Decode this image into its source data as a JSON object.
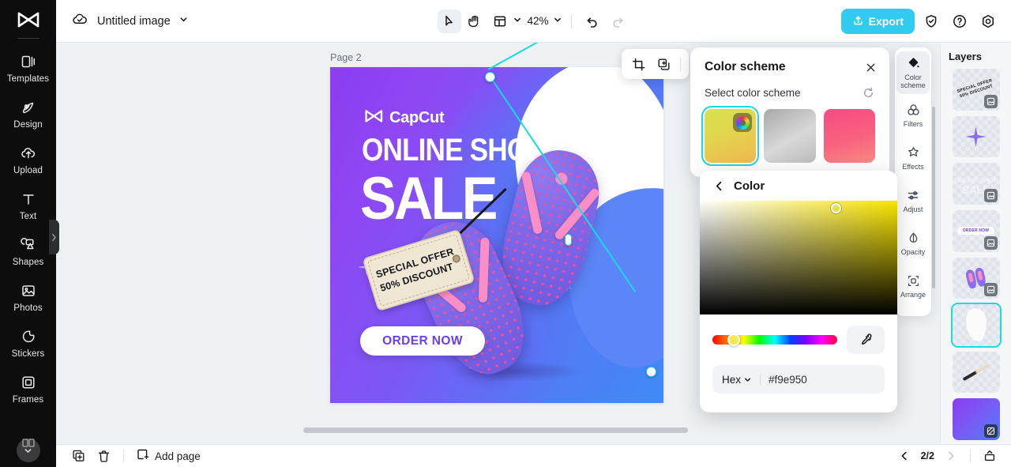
{
  "sidebar": {
    "logo_icon": "capcut-logo-icon",
    "items": [
      {
        "label": "Templates",
        "icon": "templates-icon"
      },
      {
        "label": "Design",
        "icon": "design-icon"
      },
      {
        "label": "Upload",
        "icon": "upload-cloud-icon"
      },
      {
        "label": "Text",
        "icon": "text-icon"
      },
      {
        "label": "Shapes",
        "icon": "shapes-icon"
      },
      {
        "label": "Photos",
        "icon": "photos-icon"
      },
      {
        "label": "Stickers",
        "icon": "stickers-icon"
      },
      {
        "label": "Frames",
        "icon": "frames-icon"
      }
    ],
    "collapse_icon": "chevron-right-icon",
    "expand_more_icon": "chevron-down-icon"
  },
  "topbar": {
    "cloud_icon": "cloud-saved-icon",
    "doc_title": "Untitled image",
    "doc_dropdown_icon": "chevron-down-icon",
    "tools": [
      {
        "name": "select",
        "icon": "cursor-arrow-icon",
        "active": true
      },
      {
        "name": "hand",
        "icon": "hand-icon",
        "active": false
      },
      {
        "name": "layout",
        "icon": "layout-grid-icon",
        "active": false
      }
    ],
    "layout_dropdown_icon": "chevron-down-icon",
    "zoom_level": "42%",
    "zoom_dropdown_icon": "chevron-down-icon",
    "undo_icon": "undo-icon",
    "redo_icon": "redo-icon",
    "export_label": "Export",
    "export_icon": "upload-arrow-icon",
    "export_color": "#31cbf0",
    "shield_icon": "shield-check-icon",
    "help_icon": "question-circle-icon",
    "settings_icon": "gear-icon"
  },
  "canvas": {
    "page_label": "Page 2",
    "selection_color": "#18d9e4",
    "float_toolbar": [
      {
        "name": "crop",
        "icon": "crop-icon"
      },
      {
        "name": "duplicate",
        "icon": "duplicate-icon"
      }
    ],
    "design": {
      "brand": "CapCut",
      "brand_icon": "capcut-logo-icon",
      "headline": "ONLINE SHOP",
      "subheadline": "SALE",
      "tag_line1": "SPECIAL OFFER",
      "tag_line2": "50% DISCOUNT",
      "cta_label": "ORDER NOW",
      "bg_gradient_start": "#8b3df0",
      "bg_gradient_end": "#3f8bf7",
      "cta_text_color": "#6b3df0"
    }
  },
  "color_scheme_panel": {
    "title": "Color scheme",
    "close_icon": "close-icon",
    "subtitle": "Select color scheme",
    "reset_icon": "reset-icon",
    "swatches": [
      {
        "name": "yellow-green",
        "gradient": "linear-gradient(160deg, #d6e04f 0%, #e0d84e 38%, #f0b84f 100%)",
        "selected": true,
        "has_wheel": true
      },
      {
        "name": "grayscale",
        "gradient": "linear-gradient(150deg, #a8a8a8 0%, #d8d8d8 55%, #bcbcbc 100%)",
        "selected": false,
        "has_wheel": false
      },
      {
        "name": "pink-red",
        "gradient": "linear-gradient(165deg, #f74b85 0%, #f8617e 55%, #f98a85 100%)",
        "selected": false,
        "has_wheel": false
      }
    ],
    "partial_swatch": {
      "name": "orange",
      "gradient": "linear-gradient(160deg,#ff8a3d 0%, #ff6a2b 100%)"
    }
  },
  "color_picker_panel": {
    "back_icon": "chevron-left-icon",
    "title": "Color",
    "current_color": "#f9e950",
    "hex_mode_label": "Hex",
    "hex_mode_icon": "chevron-down-icon",
    "hex_value": "#f9e950",
    "eyedropper_icon": "eyedropper-icon"
  },
  "right_rail": {
    "items": [
      {
        "label": "Color\nscheme",
        "label_l1": "Color",
        "label_l2": "scheme",
        "icon": "color-scheme-icon",
        "active": true
      },
      {
        "label": "Filters",
        "icon": "filters-icon",
        "active": false
      },
      {
        "label": "Effects",
        "icon": "effects-icon",
        "active": false
      },
      {
        "label": "Adjust",
        "icon": "adjust-sliders-icon",
        "active": false
      },
      {
        "label": "Opacity",
        "icon": "opacity-droplet-icon",
        "active": false
      },
      {
        "label": "Arrange",
        "icon": "arrange-icon",
        "active": false
      }
    ]
  },
  "layers_panel": {
    "title": "Layers",
    "items": [
      {
        "name": "layer-special-offer-tag",
        "type": "tag",
        "selected": false,
        "badge": "image-badge",
        "tag_l1": "SPECIAL OFFER",
        "tag_l2": "50% DISCOUNT"
      },
      {
        "name": "layer-sparkle",
        "type": "spark",
        "selected": false,
        "badge": null
      },
      {
        "name": "layer-online-shop-sale",
        "type": "sale",
        "selected": false,
        "badge": "image-badge",
        "brand": "CapCut",
        "line1": "ONLINE SHOP",
        "line2": "SALE"
      },
      {
        "name": "layer-order-now-button",
        "type": "pill",
        "selected": false,
        "badge": "image-badge",
        "label": "ORDER NOW"
      },
      {
        "name": "layer-flip-flops",
        "type": "flipflops",
        "selected": false,
        "badge": "image-badge"
      },
      {
        "name": "layer-white-blob",
        "type": "blob",
        "selected": true,
        "badge": null
      },
      {
        "name": "layer-brush-stroke",
        "type": "brush",
        "selected": false,
        "badge": null
      },
      {
        "name": "layer-background",
        "type": "background",
        "selected": false,
        "badge": "background-badge"
      }
    ]
  },
  "bottombar": {
    "duplicate_page_icon": "duplicate-page-icon",
    "delete_page_icon": "trash-icon",
    "add_page_icon": "add-page-icon",
    "add_page_label": "Add page",
    "prev_icon": "chevron-left-icon",
    "page_indicator": "2/2",
    "next_icon": "chevron-right-icon",
    "present_icon": "present-icon"
  }
}
